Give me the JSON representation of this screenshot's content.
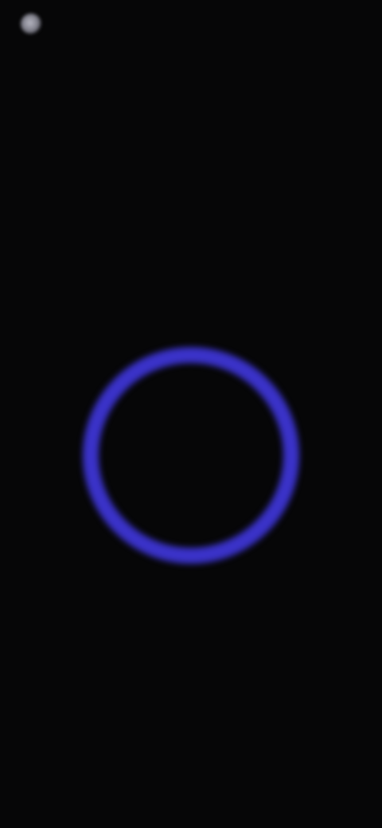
{
  "header": {
    "logo_icon": "app-logo-icon",
    "brand": ""
  },
  "screen": {
    "title": "",
    "subtitle": ""
  },
  "progress": {
    "value_label": "",
    "fraction": 1.0,
    "caption": "",
    "status_text": "",
    "ring_color": "#3a32c8",
    "track_color": "#151433"
  }
}
